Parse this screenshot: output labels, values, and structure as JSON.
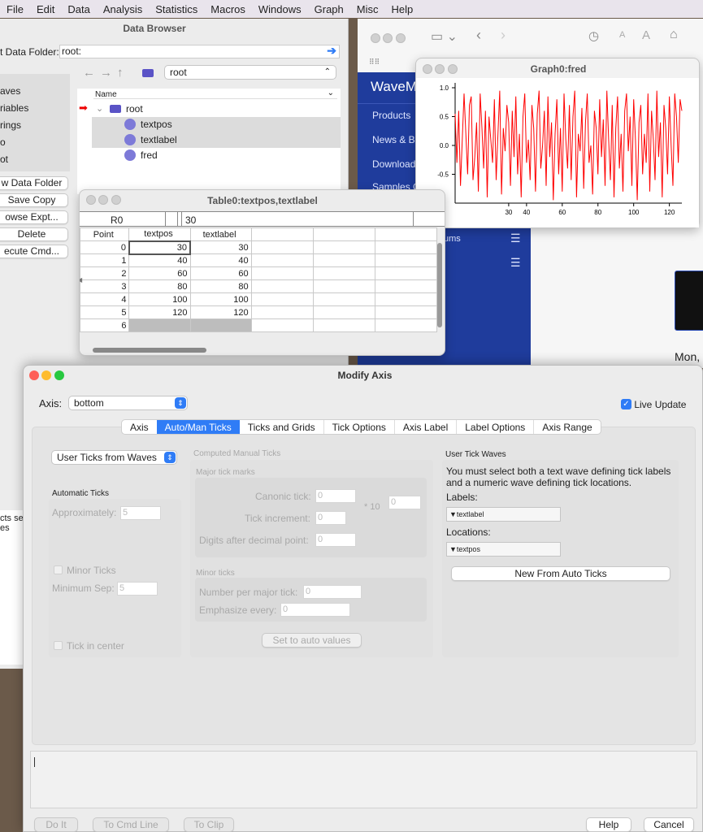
{
  "menubar": {
    "items": [
      "File",
      "Edit",
      "Data",
      "Analysis",
      "Statistics",
      "Macros",
      "Windows",
      "Graph",
      "Misc",
      "Help"
    ]
  },
  "data_browser": {
    "title": "Data Browser",
    "current_folder_label": "t Data Folder:",
    "current_folder_value": "root:",
    "folder_select": "root",
    "column_name": "Name",
    "side_items": [
      "aves",
      "riables",
      "rings",
      "o",
      "ot"
    ],
    "side_buttons": [
      "w Data Folder",
      "Save Copy",
      "owse Expt...",
      "Delete",
      "ecute Cmd..."
    ],
    "tree": {
      "root": "root",
      "children": [
        "textpos",
        "textlabel",
        "fred"
      ]
    },
    "partial_left": [
      "cts se",
      "es"
    ]
  },
  "browser": {
    "side_nav": [
      "Products",
      "News & Bl",
      "Downloads",
      "Samples C"
    ],
    "site_name": "WaveM",
    "extra": "ums",
    "date_fragment": "Mon,"
  },
  "graph": {
    "title": "Graph0:fred"
  },
  "chart_data": {
    "type": "line",
    "series": [
      {
        "name": "fred",
        "color": "#ff0000",
        "x_start": 0,
        "x_end": 127,
        "values": [
          0.55,
          -0.3,
          0.6,
          -0.7,
          0.1,
          0.9,
          0.2,
          -0.5,
          0.7,
          0.85,
          -0.6,
          -0.2,
          0.4,
          -0.8,
          0.9,
          0.3,
          -0.4,
          0.6,
          -0.9,
          0.5,
          0.1,
          -0.3,
          0.8,
          -0.6,
          0.2,
          0.95,
          -0.85,
          0.3,
          -0.1,
          0.7,
          0.4,
          -0.7,
          0.6,
          -0.2,
          0.85,
          -0.5,
          0.2,
          -0.9,
          0.5,
          0.9,
          -0.3,
          0.1,
          -0.6,
          0.7,
          0.3,
          -0.8,
          0.55,
          0.95,
          -0.4,
          0.0,
          0.6,
          -0.7,
          0.85,
          -0.2,
          0.4,
          -0.95,
          0.2,
          0.8,
          -0.5,
          0.3,
          -0.8,
          0.9,
          0.1,
          -0.4,
          0.7,
          -0.6,
          0.5,
          0.95,
          -0.9,
          0.2,
          -0.1,
          0.65,
          -0.75,
          0.4,
          0.9,
          -0.3,
          0.0,
          -0.85,
          0.6,
          0.3,
          -0.5,
          0.8,
          -0.2,
          0.45,
          -0.7,
          0.95,
          0.1,
          -0.6,
          0.7,
          -0.9,
          0.3,
          0.85,
          -0.4,
          0.2,
          -0.8,
          0.6,
          0.9,
          -0.1,
          0.5,
          -0.7,
          0.8,
          0.1,
          -0.95,
          0.4,
          0.7,
          -0.5,
          0.2,
          -0.3,
          0.9,
          -0.8,
          0.6,
          0.1,
          -0.6,
          0.95,
          -0.2,
          0.4,
          -0.9,
          0.7,
          0.3,
          -0.5,
          0.85,
          0.0,
          -0.7,
          0.9,
          0.5,
          -0.3,
          0.8,
          0.6
        ]
      }
    ],
    "xticks": [
      30,
      40,
      60,
      80,
      100,
      120
    ],
    "yticks": [
      "1.0",
      "0.5",
      "0.0",
      "-0.5"
    ],
    "ylim": [
      -1,
      1
    ],
    "xlim": [
      0,
      127
    ]
  },
  "table": {
    "title": "Table0:textpos,textlabel",
    "row_ref": "R0",
    "cell_value": "30",
    "headers": [
      "Point",
      "textpos",
      "textlabel"
    ],
    "rows": [
      [
        "0",
        "30",
        "30"
      ],
      [
        "1",
        "40",
        "40"
      ],
      [
        "2",
        "60",
        "60"
      ],
      [
        "3",
        "80",
        "80"
      ],
      [
        "4",
        "100",
        "100"
      ],
      [
        "5",
        "120",
        "120"
      ],
      [
        "6",
        "",
        ""
      ]
    ]
  },
  "modify_axis": {
    "title": "Modify Axis",
    "axis_label": "Axis:",
    "axis_value": "bottom",
    "live_update": "Live Update",
    "tabs": [
      "Axis",
      "Auto/Man Ticks",
      "Ticks and Grids",
      "Tick Options",
      "Axis Label",
      "Label Options",
      "Axis Range"
    ],
    "active_tab": "Auto/Man Ticks",
    "mode_select": "User Ticks from Waves",
    "automatic": {
      "title": "Automatic Ticks",
      "approx_label": "Approximately:",
      "approx_value": "5",
      "minor_ticks": "Minor Ticks",
      "min_sep_label": "Minimum Sep:",
      "min_sep_value": "5",
      "tick_center": "Tick in center"
    },
    "computed": {
      "title": "Computed Manual Ticks",
      "major": "Major tick marks",
      "canonic": "Canonic tick:",
      "canonic_v": "0",
      "times10": "* 10",
      "exp_v": "0",
      "increment": "Tick increment:",
      "increment_v": "0",
      "digits": "Digits after decimal point:",
      "digits_v": "0",
      "minor": "Minor ticks",
      "per_major": "Number per major tick:",
      "per_major_v": "0",
      "emphasize": "Emphasize every:",
      "emphasize_v": "0",
      "set_auto": "Set to auto values"
    },
    "user": {
      "title": "User Tick Waves",
      "desc": "You must select both a text wave defining tick labels and a numeric wave defining tick locations.",
      "labels": "Labels:",
      "labels_v": "textlabel",
      "locations": "Locations:",
      "locations_v": "textpos",
      "new_btn": "New From Auto Ticks"
    },
    "buttons": {
      "do_it": "Do It",
      "to_cmd": "To Cmd Line",
      "to_clip": "To Clip",
      "help": "Help",
      "cancel": "Cancel"
    }
  }
}
